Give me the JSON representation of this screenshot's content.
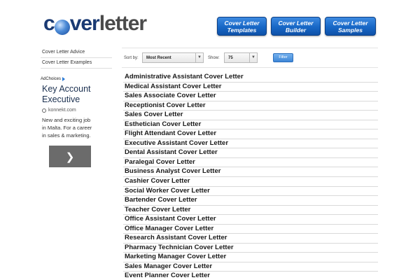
{
  "header": {
    "logo": {
      "part1": "c",
      "part2": "ver",
      "part3": "letter"
    },
    "nav_buttons": [
      {
        "line1": "Cover Letter",
        "line2": "Templates"
      },
      {
        "line1": "Cover Letter",
        "line2": "Builder"
      },
      {
        "line1": "Cover Letter",
        "line2": "Samples"
      }
    ]
  },
  "sidebar": {
    "links": [
      "Cover Letter Advice",
      "Cover Letter Examples"
    ],
    "ad": {
      "adchoices": "AdChoices",
      "title_line1": "Key Account",
      "title_line2": "Executive",
      "domain": "konnekt.com",
      "text_line1": "New and exciting job",
      "text_line2": "in Malta. For a career",
      "text_line3": "in sales & marketing.",
      "arrow_icon": "chevron-right-icon"
    }
  },
  "filter": {
    "sort_label": "Sort by:",
    "sort_value": "Most Recent",
    "show_label": "Show:",
    "show_value": "75",
    "filter_button": "Filter"
  },
  "list": {
    "items": [
      "Administrative Assistant Cover Letter",
      "Medical Assistant Cover Letter",
      "Sales Associate Cover Letter",
      "Receptionist Cover Letter",
      "Sales Cover Letter",
      "Esthetician Cover Letter",
      "Flight Attendant Cover Letter",
      "Executive Assistant Cover Letter",
      "Dental Assistant Cover Letter",
      "Paralegal Cover Letter",
      "Business Analyst Cover Letter",
      "Cashier Cover Letter",
      "Social Worker Cover Letter",
      "Bartender Cover Letter",
      "Teacher Cover Letter",
      "Office Assistant Cover Letter",
      "Office Manager Cover Letter",
      "Research Assistant Cover Letter",
      "Pharmacy Technician Cover Letter",
      "Marketing Manager Cover Letter",
      "Sales Manager Cover Letter",
      "Event Planner Cover Letter"
    ]
  },
  "colors": {
    "nav_button": "#1767c6",
    "logo_blue": "#1a3a73",
    "filter_button": "#3e86d6"
  }
}
